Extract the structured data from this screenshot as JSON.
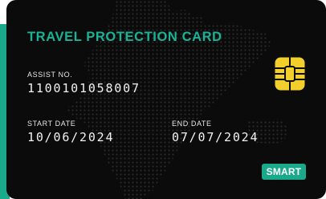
{
  "card": {
    "title": "TRAVEL PROTECTION CARD",
    "assist_label": "ASSIST NO.",
    "assist_number": "1100101058007",
    "start_label": "START DATE",
    "start_date": "10/06/2024",
    "end_label": "END DATE",
    "end_date": "07/07/2024",
    "badge": "SMART"
  },
  "colors": {
    "accent": "#1aa98b",
    "card_background": "#0b0b0b",
    "chip": "#f2cf2a"
  },
  "icons": {
    "chip": "chip-icon",
    "map": "dotted-world-map"
  }
}
